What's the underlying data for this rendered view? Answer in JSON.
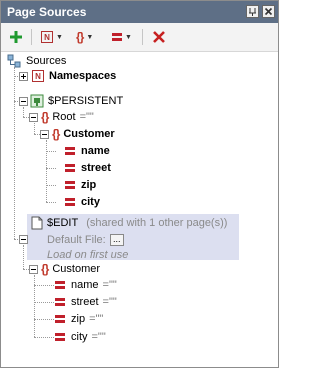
{
  "window": {
    "title": "Page Sources"
  },
  "toolbar": {
    "add_icon": "plus-icon",
    "node_icon": "namespace-node-icon",
    "element_icon": "element-braces-icon",
    "attribute_icon": "attribute-icon",
    "delete_icon": "delete-x-icon"
  },
  "tree": {
    "root_label": "Sources",
    "namespaces_label": "Namespaces",
    "persistent": {
      "label": "$PERSISTENT",
      "root_label": "Root",
      "root_value": "=\"\"",
      "customer_label": "Customer",
      "attributes": [
        "name",
        "street",
        "zip",
        "city"
      ]
    },
    "edit": {
      "label": "$EDIT",
      "shared_note": "(shared with 1 other page(s))",
      "default_file_label": "Default File:",
      "browse_button": "...",
      "load_note": "Load on first use",
      "customer_label": "Customer",
      "attributes": [
        {
          "name": "name",
          "value": "=\"\""
        },
        {
          "name": "street",
          "value": "=\"\""
        },
        {
          "name": "zip",
          "value": "=\"\""
        },
        {
          "name": "city",
          "value": "=\"\""
        }
      ]
    }
  },
  "colors": {
    "titlebar": "#5e6f86",
    "element": "#c0392b",
    "edit_highlight": "#dcdff0",
    "add": "#1f9a2f",
    "delete": "#c62020"
  }
}
